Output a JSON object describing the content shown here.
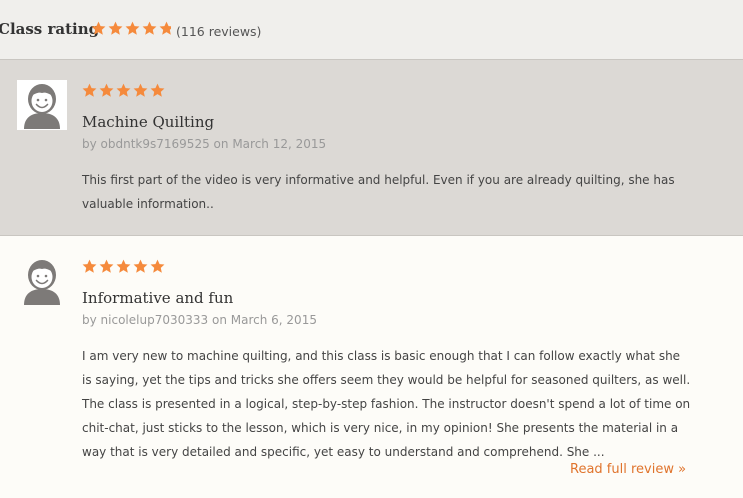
{
  "header": {
    "title": "Class rating",
    "rating": 4.8,
    "review_count": "(116 reviews)"
  },
  "colors": {
    "star": "#f58a3c",
    "link": "#e0742d",
    "highlight_bg": "#dcd9d5"
  },
  "reviews": [
    {
      "rating": 5,
      "title": "Machine Quilting",
      "author": "obdntk9s7169525",
      "date_prefix": "on",
      "date": "March 12, 2015",
      "by": "by",
      "body": "This first part of the video is very informative and helpful. Even if you are already quilting, she has valuable information.."
    },
    {
      "rating": 5,
      "title": "Informative and fun",
      "author": "nicolelup7030333",
      "date_prefix": "on",
      "date": "March 6, 2015",
      "by": "by",
      "body": "I am very new to machine quilting, and this class is basic enough that I can follow exactly what she is saying, yet the tips and tricks she offers seem they would be helpful for seasoned quilters, as well. The class is presented in a logical, step-by-step fashion. The instructor doesn't spend a lot of time on chit-chat, just sticks to the lesson, which is very nice, in my opinion! She presents the material in a way that is very detailed and specific, yet easy to understand and comprehend. She ...",
      "read_more": "Read full review »"
    }
  ]
}
